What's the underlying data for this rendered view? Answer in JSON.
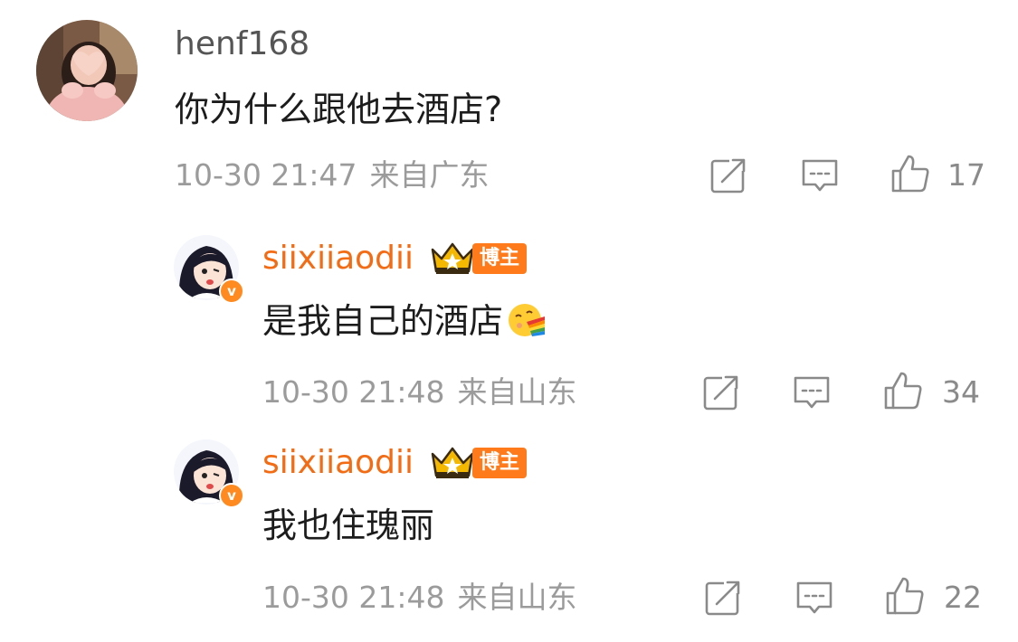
{
  "colors": {
    "username_orange": "#f36b12",
    "text_dark": "#1c1c1c",
    "meta_gray": "#9b9b9b",
    "icon_gray": "#8a8a8a",
    "badge_orange": "#ff7a1a",
    "verified_orange": "#ff8a1f",
    "username_gray": "#555555"
  },
  "comments": [
    {
      "username": "henf168",
      "text": "你为什么跟他去酒店?",
      "time": "10-30 21:47",
      "location": "来自广东",
      "likes": "17",
      "icons": [
        "share-icon",
        "reply-icon",
        "thumbs-up-icon"
      ]
    },
    {
      "username": "siixiiaodii",
      "badge": "博主",
      "text": "是我自己的酒店",
      "emoji": "rainbow-vomit-emoji",
      "time": "10-30 21:48",
      "location": "来自山东",
      "likes": "34",
      "icons": [
        "share-icon",
        "reply-icon",
        "thumbs-up-icon"
      ]
    },
    {
      "username": "siixiiaodii",
      "badge": "博主",
      "text": "我也住瑰丽",
      "time": "10-30 21:48",
      "location": "来自山东",
      "likes": "22",
      "icons": [
        "share-icon",
        "reply-icon",
        "thumbs-up-icon"
      ]
    }
  ],
  "verified_mark": "v"
}
